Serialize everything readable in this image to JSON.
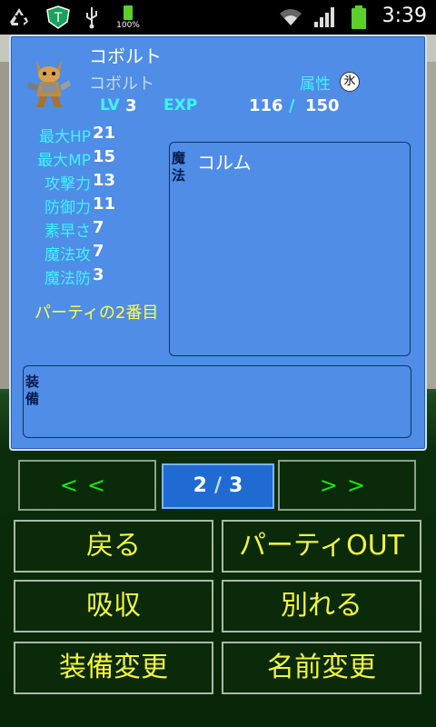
{
  "status_bar": {
    "battery_small_pct": "100%",
    "clock": "3:39"
  },
  "character": {
    "name": "コボルト",
    "species": "コボルト",
    "attribute_label": "属性",
    "attribute_value": "氷",
    "lv_label": "LV",
    "lv_value": "3",
    "exp_label": "EXP",
    "exp_current": "116",
    "exp_slash": "/",
    "exp_max": "150",
    "stats": [
      {
        "label": "最大HP",
        "value": "21"
      },
      {
        "label": "最大MP",
        "value": "15"
      },
      {
        "label": "攻撃力",
        "value": "13"
      },
      {
        "label": "防御力",
        "value": "11"
      },
      {
        "label": "素早さ",
        "value": "7"
      },
      {
        "label": "魔法攻",
        "value": "7"
      },
      {
        "label": "魔法防",
        "value": "3"
      }
    ],
    "party_position": "パーティの2番目",
    "magic_label": "魔法",
    "magic_items": [
      "コルム"
    ],
    "equip_label": "装備"
  },
  "pager": {
    "prev_label": "<<",
    "next_label": ">>",
    "current": "2",
    "slash": "/",
    "total": "3"
  },
  "commands": {
    "back": "戻る",
    "party_out": "パーティOUT",
    "absorb": "吸収",
    "separate": "別れる",
    "change_equip": "装備変更",
    "rename": "名前変更"
  }
}
